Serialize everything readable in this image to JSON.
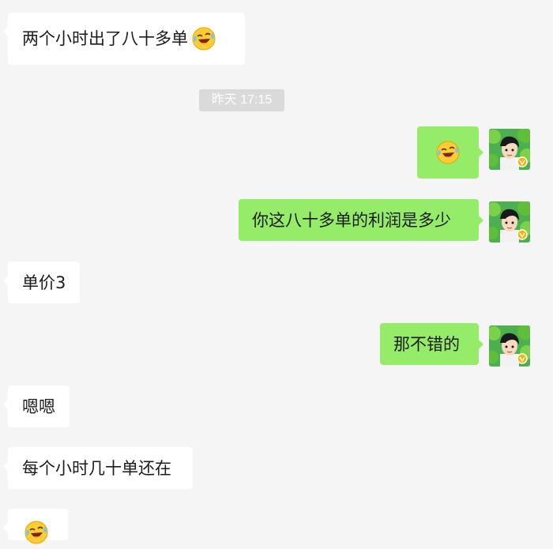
{
  "chat": {
    "timestamp": "昨天 17:15",
    "messages": [
      {
        "sender": "other",
        "text": "两个小时出了八十多单",
        "emoji": "rolling-on-floor-laughing"
      },
      {
        "sender": "self",
        "text": "",
        "emoji": "rolling-on-floor-laughing"
      },
      {
        "sender": "self",
        "text": "你这八十多单的利润是多少"
      },
      {
        "sender": "other",
        "text": "单价3"
      },
      {
        "sender": "self",
        "text": "那不错的"
      },
      {
        "sender": "other",
        "text": "嗯嗯"
      },
      {
        "sender": "other",
        "text": "每个小时几十单还在"
      },
      {
        "sender": "other",
        "text": "",
        "emoji": "rolling-on-floor-laughing"
      }
    ]
  },
  "colors": {
    "background": "#f5f5f5",
    "self_bubble": "#95ec69",
    "other_bubble": "#ffffff",
    "timestamp_bg": "#dadada",
    "verified_badge": "#f5b400"
  },
  "icons": {
    "emoji": "rolling-on-floor-laughing-emoji",
    "avatar": "user-avatar-cartoon-boy",
    "badge": "verified-v-badge"
  }
}
